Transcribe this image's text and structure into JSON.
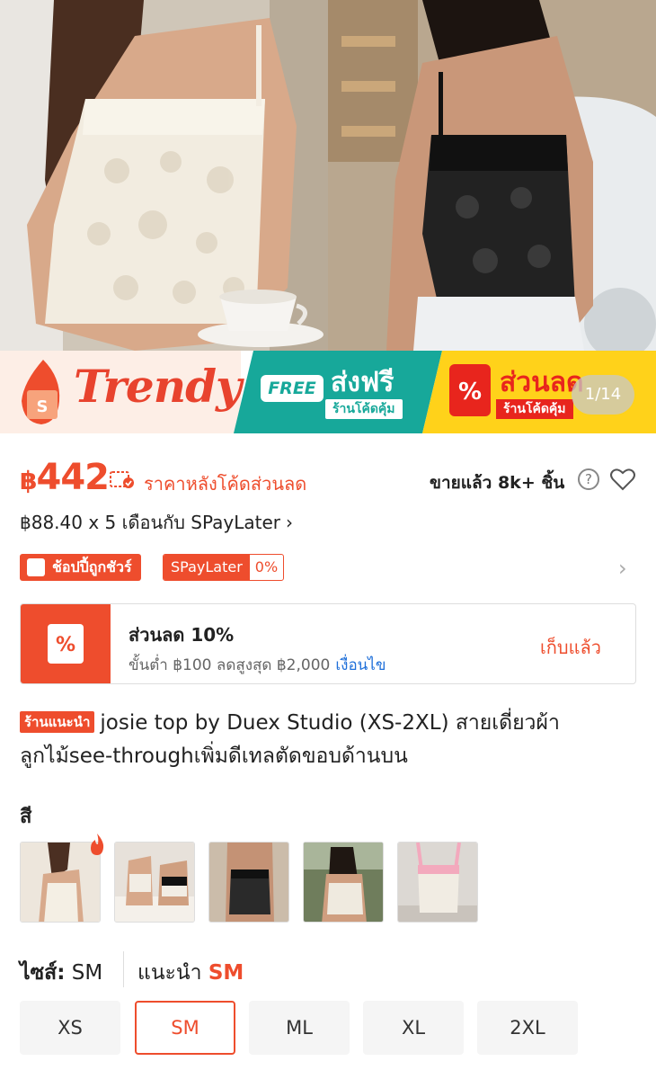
{
  "gallery": {
    "counter": "1/14"
  },
  "promo": {
    "trendy_label": "Trendy",
    "free_badge": "FREE",
    "free_title": "ส่งฟรี",
    "free_sub": "ร้านโค้ดคุ้ม",
    "discount_title": "ส่วนลด",
    "discount_sub": "ร้านโค้ดคุ้ม",
    "discount_icon": "%"
  },
  "price": {
    "currency": "฿",
    "amount": "442",
    "note": "ราคาหลังโค้ดส่วนลด",
    "sold": "ขายแล้ว 8k+ ชิ้น",
    "installment": "฿88.40 x 5 เดือนกับ SPayLater",
    "installment_chevron": "›",
    "help_icon": "?"
  },
  "badges": {
    "shopee_guarantee": "ช้อปปี้ถูกชัวร์",
    "spay_label": "SPayLater",
    "spay_rate": "0%",
    "chevron": "›"
  },
  "voucher": {
    "title": "ส่วนลด 10%",
    "condition": "ขั้นต่ำ ฿100 ลดสูงสุด ฿2,000",
    "condition_link": "เงื่อนไข",
    "action": "เก็บแล้ว",
    "icon": "%"
  },
  "product": {
    "tag": "ร้านแนะนำ",
    "title": "josie top by Duex Studio (XS-2XL) สายเดี่ยวผ้าลูกไม้see-throughเพิ่มดีเทลตัดขอบด้านบน"
  },
  "colors": {
    "label": "สี",
    "swatches": [
      "white-lace-model",
      "white-black-model",
      "black-lace-top",
      "model-outdoor",
      "pink-strap-top"
    ]
  },
  "sizes": {
    "label": "ไซส์:",
    "selected": "SM",
    "recommend_label": "แนะนำ",
    "recommend_value": "SM",
    "options": [
      "XS",
      "SM",
      "ML",
      "XL",
      "2XL"
    ]
  },
  "colors_theme": {
    "accent": "#ee4d2d",
    "link": "#1e6fd9"
  }
}
